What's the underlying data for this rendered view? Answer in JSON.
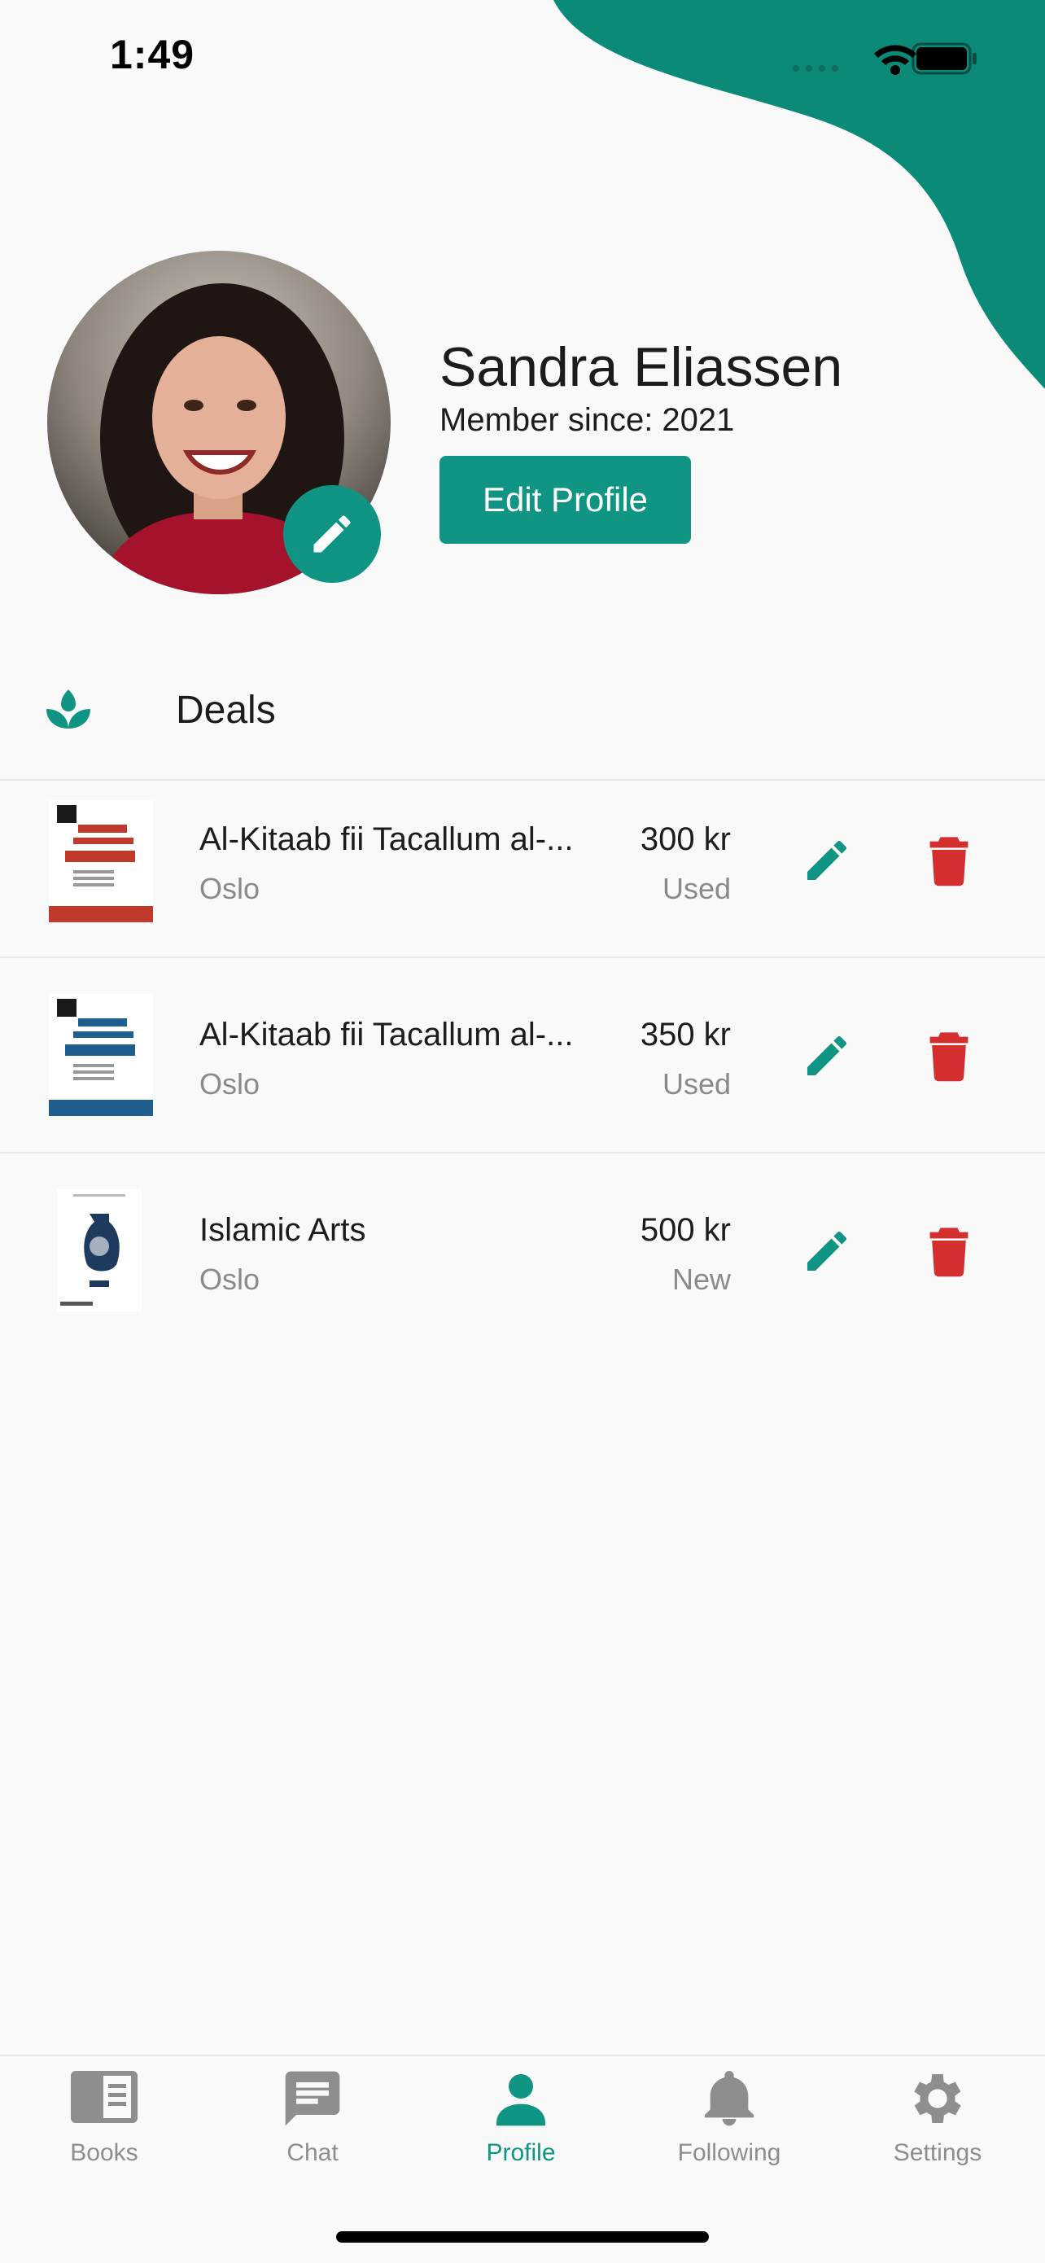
{
  "status_bar": {
    "time": "1:49"
  },
  "profile": {
    "name": "Sandra Eliassen",
    "member_since": "Member since: 2021",
    "edit_button": "Edit Profile"
  },
  "deals": {
    "heading": "Deals",
    "items": [
      {
        "title": "Al-Kitaab fii Tacallum al-...",
        "city": "Oslo",
        "price": "300 kr",
        "condition": "Used"
      },
      {
        "title": "Al-Kitaab fii Tacallum al-...",
        "city": "Oslo",
        "price": "350 kr",
        "condition": "Used"
      },
      {
        "title": "Islamic Arts",
        "city": "Oslo",
        "price": "500 kr",
        "condition": "New"
      }
    ]
  },
  "tabs": [
    {
      "label": "Books",
      "icon": "book-icon"
    },
    {
      "label": "Chat",
      "icon": "chat-icon"
    },
    {
      "label": "Profile",
      "icon": "person-icon",
      "active": true
    },
    {
      "label": "Following",
      "icon": "bell-icon"
    },
    {
      "label": "Settings",
      "icon": "gear-icon"
    }
  ],
  "colors": {
    "accent": "#109483",
    "delete": "#d32f2f",
    "inactive": "#8e8e8e"
  }
}
